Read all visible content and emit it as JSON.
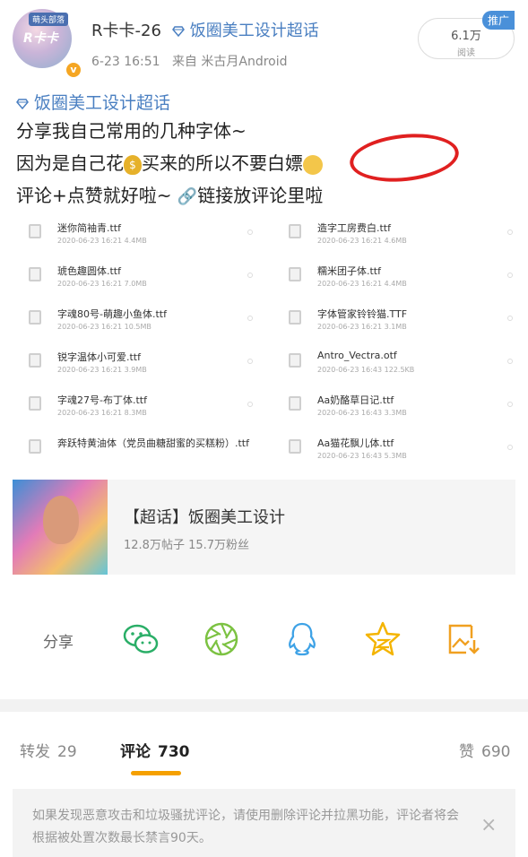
{
  "header": {
    "username": "R卡卡-26",
    "supertopic": "饭圈美工设计超话",
    "timestamp": "6-23 16:51",
    "source": "来自 米古月Android",
    "reads_count": "6.1万",
    "reads_label": "阅读",
    "promo_label": "推广",
    "avatar_tag": "萌头部落",
    "avatar_text": "R卡卡",
    "verified_badge": "v"
  },
  "post": {
    "topic": "饭圈美工设计超话",
    "line1": "分享我自己常用的几种字体~",
    "line2_a": "因为是自己花",
    "line2_b": "买来的所以不要白嫖",
    "line3_a": "评论+点赞就好啦~",
    "line3_b": "链接放评论里啦",
    "emoji_money": "$"
  },
  "screenshot": {
    "left": [
      {
        "name": "迷你简袖青.ttf",
        "meta": "2020-06-23  16:21  4.4MB"
      },
      {
        "name": "琥色趣圆体.ttf",
        "meta": "2020-06-23  16:21  7.0MB"
      },
      {
        "name": "字魂80号-萌趣小鱼体.ttf",
        "meta": "2020-06-23  16:21  10.5MB"
      },
      {
        "name": "锐字温体小可爱.ttf",
        "meta": "2020-06-23  16:21  3.9MB"
      },
      {
        "name": "字魂27号-布丁体.ttf",
        "meta": "2020-06-23  16:21  8.3MB"
      },
      {
        "name": "奔跃特黄油体（党员曲糖甜蜜的买糕粉）.ttf",
        "meta": ""
      }
    ],
    "right": [
      {
        "name": "造字工房费白.ttf",
        "meta": "2020-06-23  16:21  4.6MB"
      },
      {
        "name": "糯米团子体.ttf",
        "meta": "2020-06-23  16:21  4.4MB"
      },
      {
        "name": "字体管家铃铃猫.TTF",
        "meta": "2020-06-23  16:21  3.1MB"
      },
      {
        "name": "Antro_Vectra.otf",
        "meta": "2020-06-23  16:43  122.5KB"
      },
      {
        "name": "Aa奶酪草日记.ttf",
        "meta": "2020-06-23  16:43  3.3MB"
      },
      {
        "name": "Aa猫花飘儿体.ttf",
        "meta": "2020-06-23  16:43  5.3MB"
      }
    ]
  },
  "topic_card": {
    "title": "【超话】饭圈美工设计",
    "stats": "12.8万帖子  15.7万粉丝"
  },
  "share": {
    "label": "分享",
    "targets": [
      "wechat",
      "moments",
      "qq",
      "qzone",
      "save-image"
    ]
  },
  "tabs": {
    "repost_label": "转发",
    "repost_count": "29",
    "comment_label": "评论",
    "comment_count": "730",
    "like_label": "赞",
    "like_count": "690"
  },
  "notice": {
    "text": "如果发现恶意攻击和垃圾骚扰评论，请使用删除评论并拉黑功能，评论者将会根据被处置次数最长禁言90天。",
    "close": "×"
  },
  "colors": {
    "accent_blue": "#4a7fc1",
    "tab_underline": "#f5a000",
    "annotation_red": "#e02020",
    "wechat_green": "#2aae67",
    "moments_green": "#7cc242",
    "qq_blue": "#3ea2e6",
    "qzone_yellow": "#f4b400",
    "save_orange": "#f0a020"
  }
}
